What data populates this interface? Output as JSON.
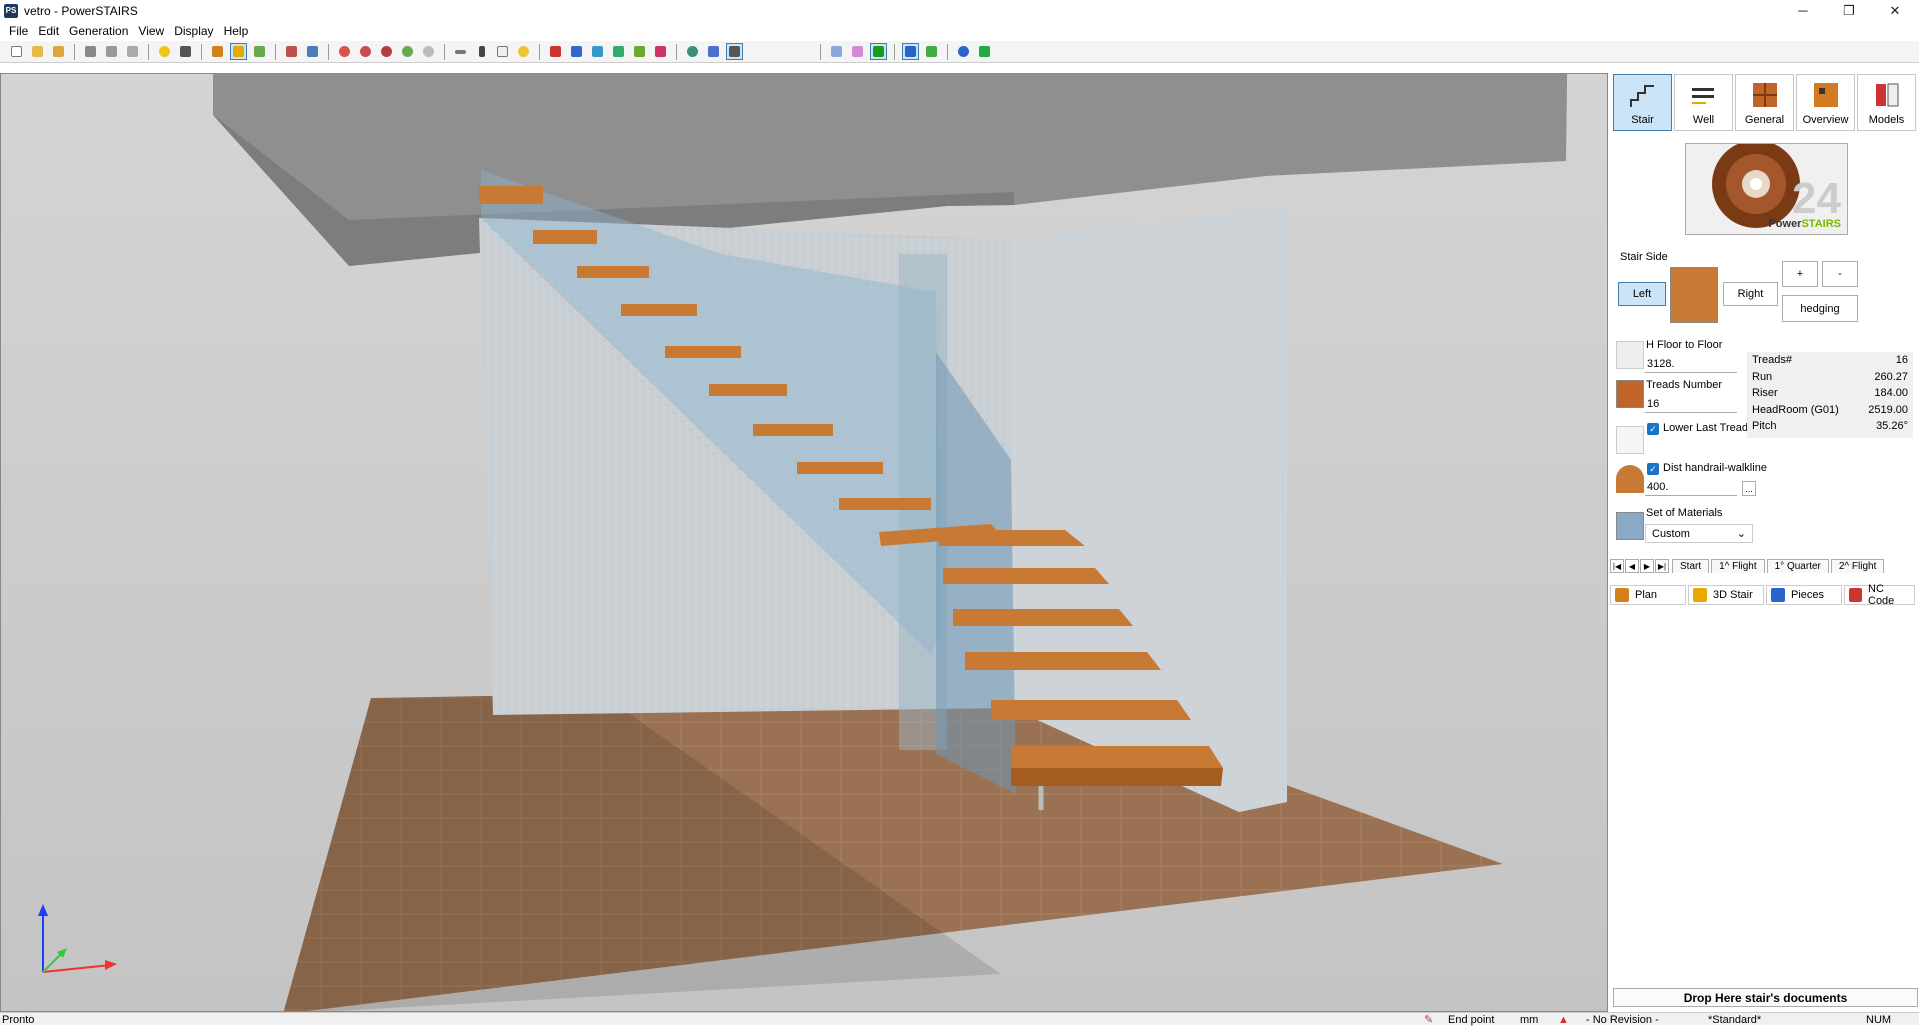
{
  "window": {
    "title": "vetro - PowerSTAIRS",
    "app_icon_text": "PS",
    "minimize": "─",
    "maximize": "❐",
    "close": "✕"
  },
  "menu": [
    "File",
    "Edit",
    "Generation",
    "View",
    "Display",
    "Help"
  ],
  "panel": {
    "top_buttons": [
      {
        "label": "Stair",
        "active": true
      },
      {
        "label": "Well",
        "active": false
      },
      {
        "label": "General",
        "active": false
      },
      {
        "label": "Overview",
        "active": false
      },
      {
        "label": "Models",
        "active": false
      }
    ],
    "logo": {
      "number": "24",
      "brand_a": "Power",
      "brand_b": "STAIRS"
    },
    "stair_side": {
      "label": "Stair Side",
      "left": "Left",
      "right": "Right",
      "selected": "Left"
    },
    "plus": "+",
    "minus": "-",
    "hedging": "hedging",
    "h_floor": {
      "label": "H Floor to Floor",
      "value": "3128."
    },
    "treads_number": {
      "label": "Treads Number",
      "value": "16"
    },
    "lower_last_tread": {
      "label": "Lower Last Tread",
      "checked": true
    },
    "dist_handrail": {
      "label": "Dist handrail-walkline",
      "value": "400.",
      "checked": true,
      "more": "..."
    },
    "materials": {
      "label": "Set of Materials",
      "value": "Custom"
    },
    "summary": [
      {
        "key": "Treads#",
        "val": "16"
      },
      {
        "key": "Run",
        "val": "260.27"
      },
      {
        "key": "Riser",
        "val": "184.00"
      },
      {
        "key": "HeadRoom (G01)",
        "val": "2519.00"
      },
      {
        "key": "Pitch",
        "val": "35.26°"
      }
    ],
    "nav_buttons": [
      "|◀",
      "◀",
      "▶",
      "▶|"
    ],
    "flight_tabs": [
      "Start",
      "1^ Flight",
      "1° Quarter",
      "2^ Flight"
    ],
    "view_tabs": [
      {
        "label": "Plan",
        "icon": "plan-icon"
      },
      {
        "label": "3D Stair",
        "icon": "stair-3d-icon"
      },
      {
        "label": "Pieces",
        "icon": "pieces-icon"
      },
      {
        "label": "NC Code",
        "icon": "nc-code-icon"
      }
    ],
    "drop_zone": "Drop Here stair's documents"
  },
  "status": {
    "left": "Pronto",
    "snap": "End point",
    "unit": "mm",
    "revision": "- No Revision -",
    "style": "*Standard*",
    "num": "NUM"
  },
  "colors": {
    "accent": "#3c7fb1",
    "selected_bg": "#cce4f7",
    "wood": "#c87a34",
    "glass": "#8fb4cf",
    "floor": "#9c7458"
  }
}
